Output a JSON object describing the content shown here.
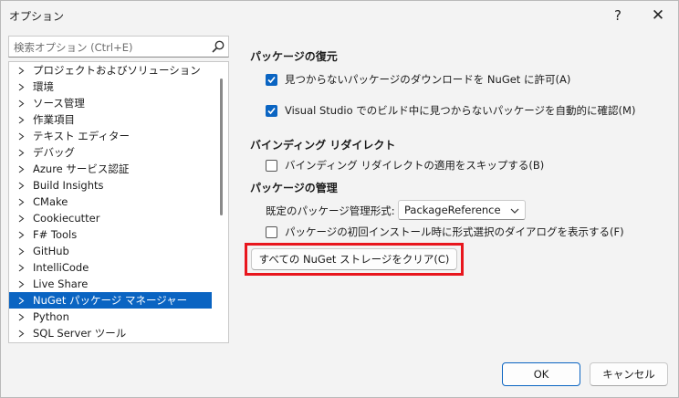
{
  "window": {
    "title": "オプション",
    "help_label": "?",
    "close_label": "✕"
  },
  "search": {
    "placeholder": "検索オプション (Ctrl+E)"
  },
  "tree": {
    "items": [
      {
        "label": "プロジェクトおよびソリューション"
      },
      {
        "label": "環境"
      },
      {
        "label": "ソース管理"
      },
      {
        "label": "作業項目"
      },
      {
        "label": "テキスト エディター"
      },
      {
        "label": "デバッグ"
      },
      {
        "label": "Azure サービス認証"
      },
      {
        "label": "Build Insights"
      },
      {
        "label": "CMake"
      },
      {
        "label": "Cookiecutter"
      },
      {
        "label": "F# Tools"
      },
      {
        "label": "GitHub"
      },
      {
        "label": "IntelliCode"
      },
      {
        "label": "Live Share"
      },
      {
        "label": "NuGet パッケージ マネージャー",
        "selected": true
      },
      {
        "label": "Python"
      },
      {
        "label": "SQL Server ツール"
      }
    ]
  },
  "restore": {
    "title": "パッケージの復元",
    "allow_download": "見つからないパッケージのダウンロードを NuGet に許可(A)",
    "allow_download_checked": true,
    "auto_check": "Visual Studio でのビルド中に見つからないパッケージを自動的に確認(M)",
    "auto_check_checked": true
  },
  "binding": {
    "title": "バインディング リダイレクト",
    "skip": "バインディング リダイレクトの適用をスキップする(B)",
    "skip_checked": false
  },
  "management": {
    "title": "パッケージの管理",
    "format_label": "既定のパッケージ管理形式:",
    "format_value": "PackageReference",
    "show_dialog": "パッケージの初回インストール時に形式選択のダイアログを表示する(F)",
    "show_dialog_checked": false,
    "clear_button": "すべての NuGet ストレージをクリア(C)"
  },
  "footer": {
    "ok": "OK",
    "cancel": "キャンセル"
  },
  "colors": {
    "accent": "#0a64c2",
    "highlight": "#e8161d"
  }
}
